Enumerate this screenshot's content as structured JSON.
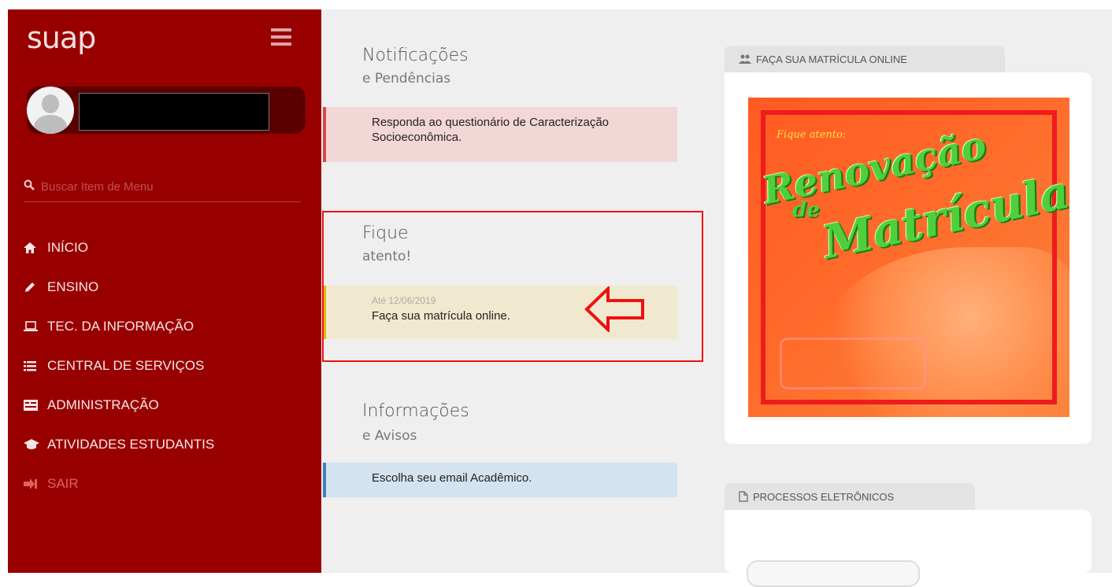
{
  "sidebar": {
    "logo": "suap",
    "user_name": "",
    "search_placeholder": "Buscar Item de Menu",
    "menu": [
      {
        "label": "INÍCIO",
        "icon": "home-icon"
      },
      {
        "label": "ENSINO",
        "icon": "pencil-icon"
      },
      {
        "label": "TEC. DA INFORMAÇÃO",
        "icon": "laptop-icon"
      },
      {
        "label": "CENTRAL DE SERVIÇOS",
        "icon": "list-icon"
      },
      {
        "label": "ADMINISTRAÇÃO",
        "icon": "building-icon"
      },
      {
        "label": "ATIVIDADES ESTUDANTIS",
        "icon": "graduation-cap-icon"
      },
      {
        "label": "SAIR",
        "icon": "sign-out-icon"
      }
    ]
  },
  "notifications": {
    "title": "Notificações",
    "subtitle": "e Pendências",
    "items": [
      {
        "text": "Responda ao questionário de Caracterização Socioeconômica."
      }
    ]
  },
  "attention": {
    "title": "Fique",
    "subtitle": "atento!",
    "items": [
      {
        "date": "Até 12/06/2019",
        "text": "Faça sua matrícula online."
      }
    ]
  },
  "info": {
    "title": "Informações",
    "subtitle": "e Avisos",
    "items": [
      {
        "text": "Escolha seu email Acadêmico."
      }
    ]
  },
  "widgets": {
    "matricula": {
      "label": "FAÇA SUA MATRÍCULA ONLINE",
      "icon": "users-icon",
      "banner": {
        "line1": "Fique atento:",
        "line2": "Renovação",
        "line3": "de",
        "line4": "Matrícula"
      }
    },
    "processos": {
      "label": "PROCESSOS ELETRÔNICOS",
      "icon": "file-icon"
    }
  },
  "colors": {
    "sidebar": "#980000",
    "danger": "#d44a4a",
    "warning": "#e0b800",
    "info": "#3d82b8",
    "highlight": "#ee1111"
  }
}
